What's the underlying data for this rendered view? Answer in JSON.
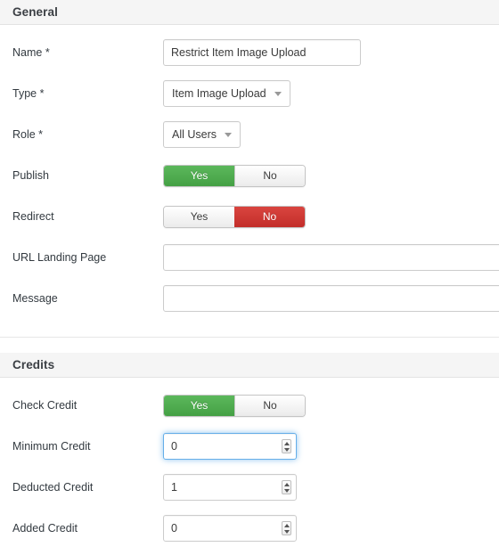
{
  "sections": [
    {
      "title": "General",
      "rows": [
        {
          "label": "Name *",
          "control": "text",
          "value": "Restrict Item Image Upload",
          "placeholder": ""
        },
        {
          "label": "Type *",
          "control": "dropdown",
          "value": "Item Image Upload"
        },
        {
          "label": "Role *",
          "control": "dropdown",
          "value": "All Users"
        },
        {
          "label": "Publish",
          "control": "toggle",
          "yes_label": "Yes",
          "no_label": "No",
          "selected": "Yes"
        },
        {
          "label": "Redirect",
          "control": "toggle",
          "yes_label": "Yes",
          "no_label": "No",
          "selected": "No"
        },
        {
          "label": "URL Landing Page",
          "control": "text-wide",
          "value": "",
          "placeholder": ""
        },
        {
          "label": "Message",
          "control": "text-wide",
          "value": "",
          "placeholder": ""
        }
      ]
    },
    {
      "title": "Credits",
      "rows": [
        {
          "label": "Check Credit",
          "control": "toggle",
          "yes_label": "Yes",
          "no_label": "No",
          "selected": "Yes"
        },
        {
          "label": "Minimum Credit",
          "control": "number",
          "value": "0",
          "focused": true
        },
        {
          "label": "Deducted Credit",
          "control": "number",
          "value": "1",
          "focused": false
        },
        {
          "label": "Added Credit",
          "control": "number",
          "value": "0",
          "focused": false
        }
      ]
    }
  ],
  "colors": {
    "toggle_on_green": "#5cb85c",
    "toggle_on_red": "#c9302c",
    "focus_blue": "#66afe9",
    "header_bg": "#f5f5f5",
    "border": "#cccccc"
  },
  "icons": {
    "caret": "chevron-down-icon",
    "spinner": "number-spinner-icon"
  }
}
